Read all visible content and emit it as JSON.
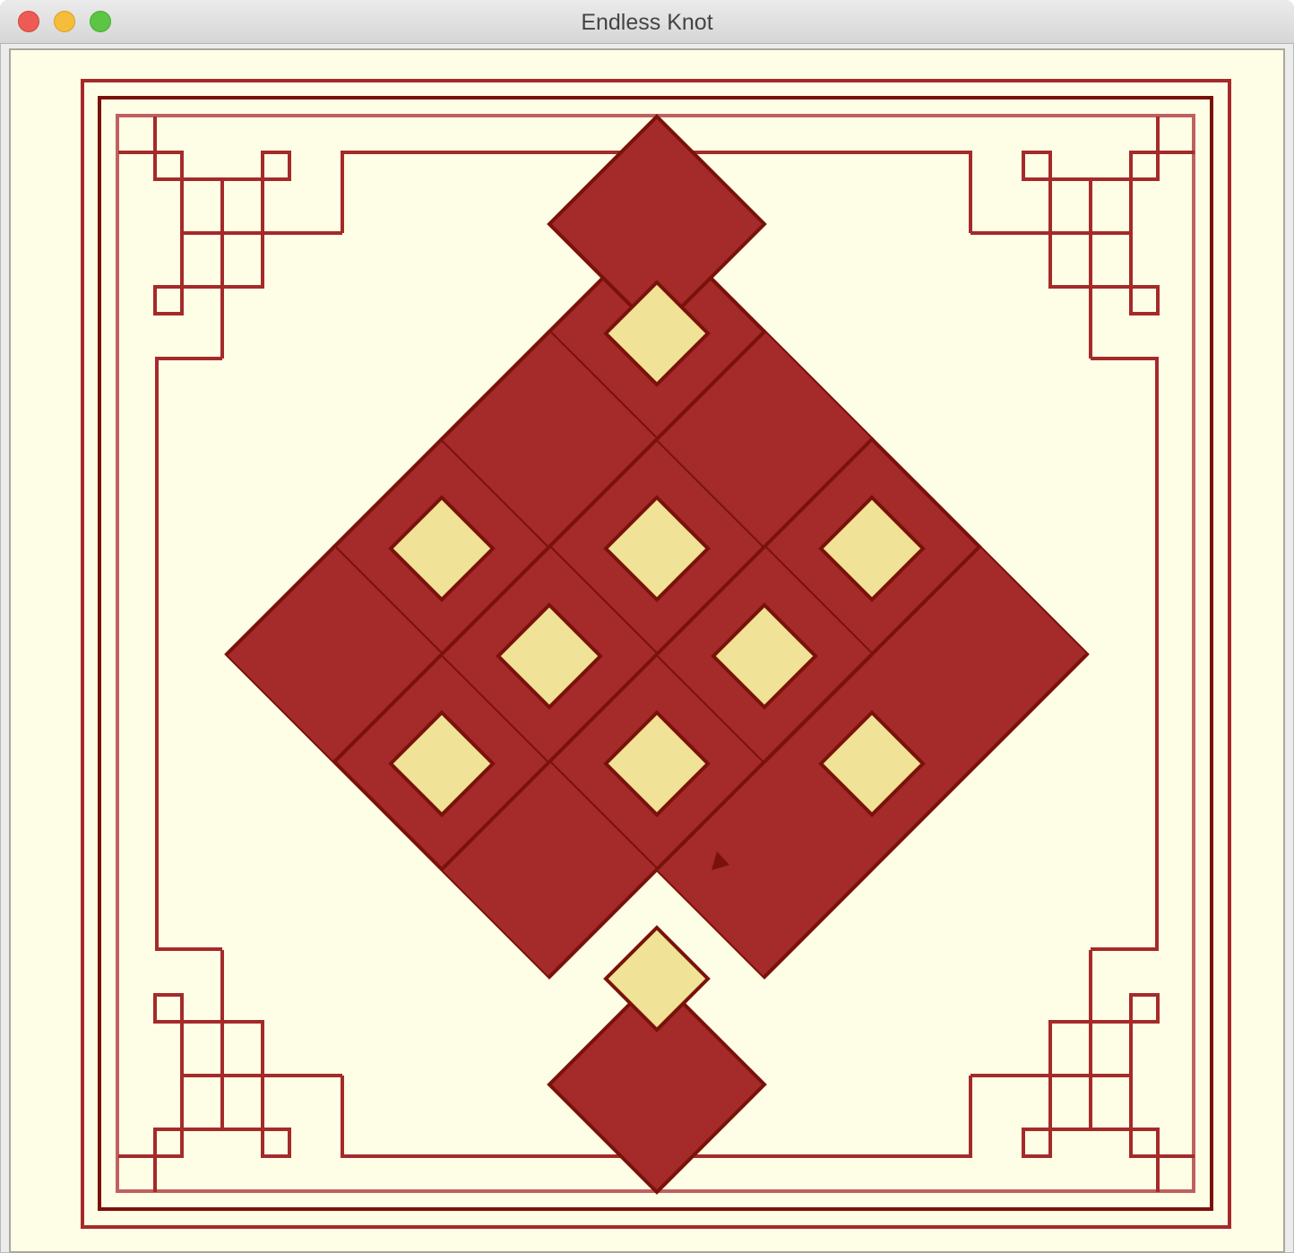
{
  "window": {
    "title": "Endless Knot",
    "controls": [
      "close",
      "minimize",
      "zoom"
    ]
  },
  "colors": {
    "background": "#fefee6",
    "knot_fill": "#a52a2a",
    "knot_outline": "#7a120a",
    "hole_fill": "#f0e296",
    "border_line": "#a52a2a",
    "border_dark": "#7a120a",
    "border_light": "#c06060"
  },
  "drawing": {
    "subject": "endless-knot",
    "hole_count": 10,
    "corner_ornaments": [
      "top-left",
      "top-right",
      "bottom-left",
      "bottom-right"
    ]
  }
}
